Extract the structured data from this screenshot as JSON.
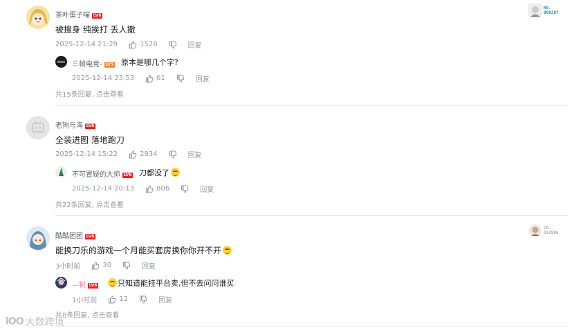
{
  "comments": [
    {
      "user": "茶叶蛋子喵",
      "level": "LV6",
      "content": "被搜身 纯挨打 丢人撤",
      "time": "2025-12-14 21:29",
      "likes": "1528",
      "reply_label": "回复",
      "badge": {
        "line1": "NO.",
        "line2": "000287"
      },
      "sub": {
        "user": "三帧电竞-",
        "level": "LV5",
        "content": "原本是哪几个字?",
        "time": "2025-12-14 23:53",
        "likes": "61",
        "reply_label": "回复"
      },
      "more": {
        "count_text": "共15条回复,",
        "link": "点击查看"
      }
    },
    {
      "user": "老狗与海",
      "level": "LV6",
      "content": "全装进图 落地跑刀",
      "time": "2025-12-14 15:22",
      "likes": "2934",
      "reply_label": "回复",
      "sub": {
        "user": "不可置疑的大师",
        "level": "LV6",
        "content": "刀都没了",
        "time": "2025-12-14 20:13",
        "likes": "806",
        "reply_label": "回复"
      },
      "more": {
        "count_text": "共22条回复,",
        "link": "点击查看"
      }
    },
    {
      "user": "酷酷团团",
      "level": "LV6",
      "content": "能换刀乐的游戏一个月能买套房换你你开不开",
      "time": "3小时前",
      "likes": "30",
      "reply_label": "回复",
      "badge": {
        "line1": "CO.",
        "line2": "013986"
      },
      "sub": {
        "user": "—祝",
        "level": "LV6",
        "content": "只知道能挂平台卖,但不去问问谁买",
        "time": "1小时前",
        "likes": "12",
        "reply_label": "回复"
      },
      "more": {
        "count_text": "共8条回复,",
        "link": "点击查看"
      }
    }
  ],
  "watermark": {
    "mark": "lOO",
    "text": "大数跨境"
  },
  "icons": {
    "like": "thumb-up-icon",
    "dislike": "thumb-down-icon",
    "emoji": "laughing-emoji-icon"
  },
  "colors": {
    "level_red": "#ff1a1a",
    "level_orange": "#ff7f24",
    "meta_gray": "#9499a0",
    "name_pink": "#fb7299"
  }
}
